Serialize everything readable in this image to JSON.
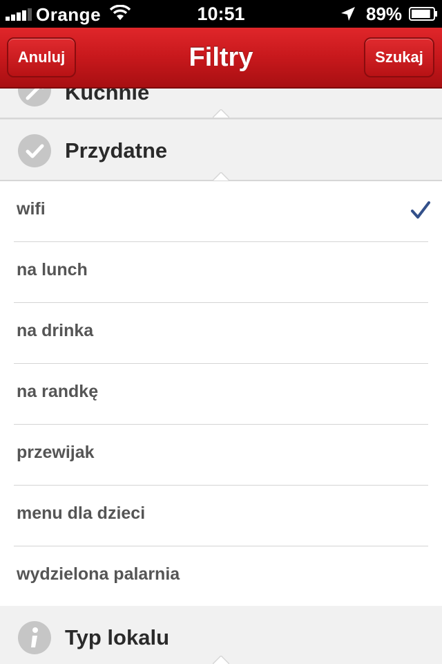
{
  "status_bar": {
    "carrier": "Orange",
    "time": "10:51",
    "battery": "89%",
    "battery_level": 0.89
  },
  "nav": {
    "cancel_label": "Anuluj",
    "title": "Filtry",
    "search_label": "Szukaj"
  },
  "sections": {
    "kuchnie": {
      "label": "Kuchnie",
      "icon": "fork-knife-icon"
    },
    "przydatne": {
      "label": "Przydatne",
      "icon": "checkmark-circle-icon"
    },
    "typ_lokalu": {
      "label": "Typ lokalu",
      "icon": "info-icon"
    }
  },
  "items": [
    {
      "label": "wifi",
      "checked": true
    },
    {
      "label": "na lunch",
      "checked": false
    },
    {
      "label": "na drinka",
      "checked": false
    },
    {
      "label": "na randkę",
      "checked": false
    },
    {
      "label": "przewijak",
      "checked": false
    },
    {
      "label": "menu dla dzieci",
      "checked": false
    },
    {
      "label": "wydzielona palarnia",
      "checked": false
    }
  ],
  "colors": {
    "nav_red": "#c7181c",
    "check_blue": "#33508a",
    "section_bg": "#f1f1f1"
  }
}
